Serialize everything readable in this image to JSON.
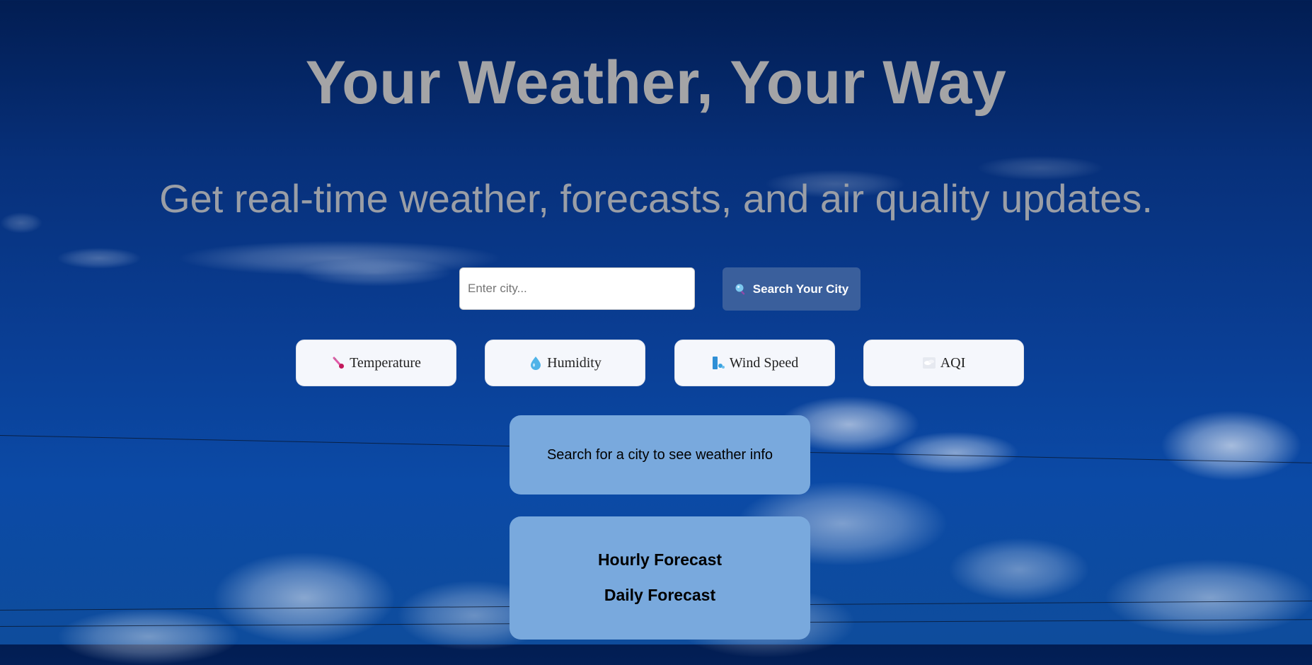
{
  "hero": {
    "title": "Your Weather, Your Way",
    "subtitle": "Get real-time weather, forecasts, and air quality updates."
  },
  "search": {
    "placeholder": "Enter city...",
    "value": "",
    "button_label": "Search Your City",
    "button_icon": "magnifier-icon"
  },
  "metrics": [
    {
      "label": "Temperature",
      "icon": "thermometer-icon"
    },
    {
      "label": "Humidity",
      "icon": "droplet-icon"
    },
    {
      "label": "Wind Speed",
      "icon": "wind-icon"
    },
    {
      "label": "AQI",
      "icon": "fog-icon"
    }
  ],
  "info": {
    "message": "Search for a city to see weather info"
  },
  "forecast": {
    "hourly_label": "Hourly Forecast",
    "daily_label": "Daily Forecast"
  },
  "colors": {
    "button": "#3a5f9c",
    "card": "#79a9dd",
    "title_text": "#a4a4a6"
  }
}
